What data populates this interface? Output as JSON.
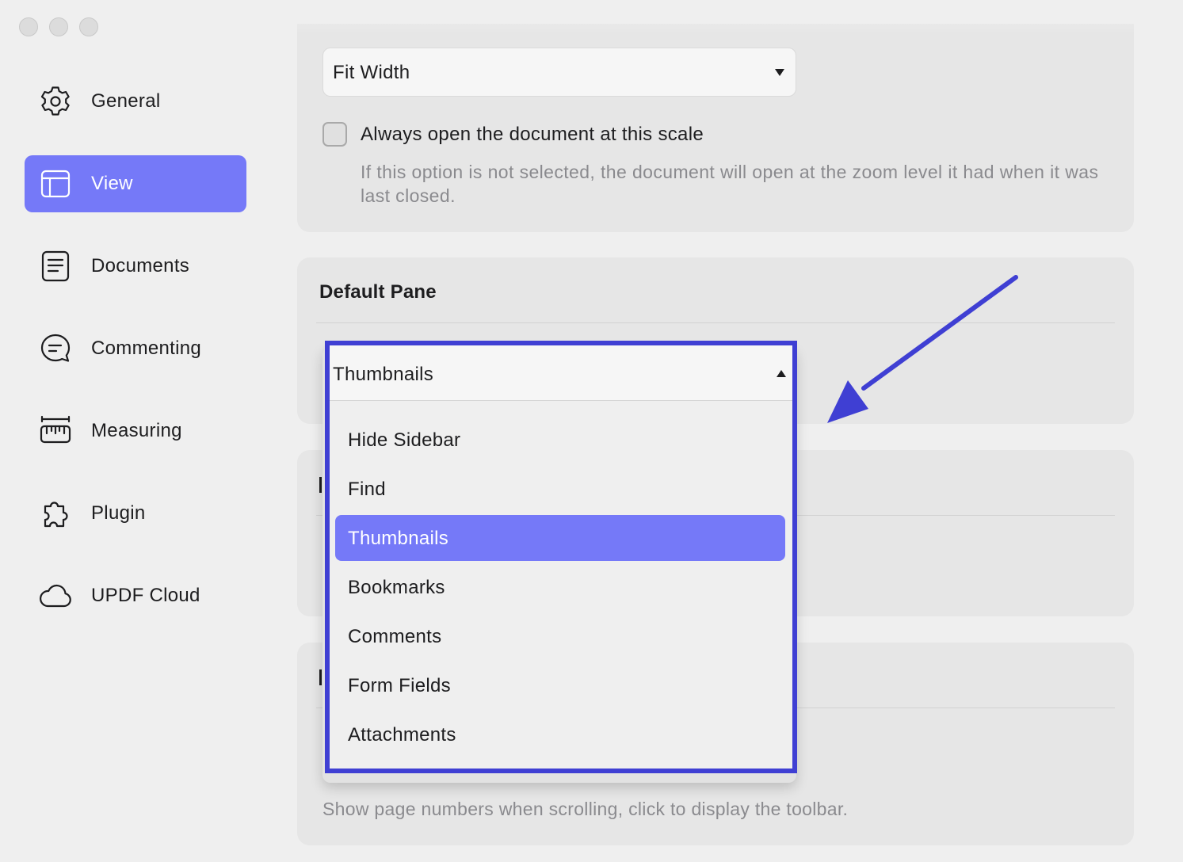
{
  "theme": {
    "accent": "#7579f8",
    "annotation": "#3f3fd3",
    "hint_text": "#8a8a8e"
  },
  "sidebar": {
    "items": [
      {
        "label": "General",
        "icon": "gear-icon"
      },
      {
        "label": "View",
        "icon": "layout-icon",
        "active": true
      },
      {
        "label": "Documents",
        "icon": "document-icon"
      },
      {
        "label": "Commenting",
        "icon": "comment-icon"
      },
      {
        "label": "Measuring",
        "icon": "ruler-icon"
      },
      {
        "label": "Plugin",
        "icon": "puzzle-icon"
      },
      {
        "label": "UPDF Cloud",
        "icon": "cloud-icon"
      }
    ]
  },
  "zoom": {
    "selected": "Fit Width",
    "always_open_label": "Always open the document at this scale",
    "always_open_checked": false,
    "always_open_hint": "If this option is not selected, the document will open at the zoom level it had when it was last closed."
  },
  "default_pane": {
    "title": "Default Pane",
    "selected": "Thumbnails",
    "options": [
      "Hide Sidebar",
      "Find",
      "Thumbnails",
      "Bookmarks",
      "Comments",
      "Form Fields",
      "Attachments"
    ],
    "selected_index": 2
  },
  "page_numbers": {
    "hint": "Show page numbers when scrolling, click to display the toolbar."
  }
}
